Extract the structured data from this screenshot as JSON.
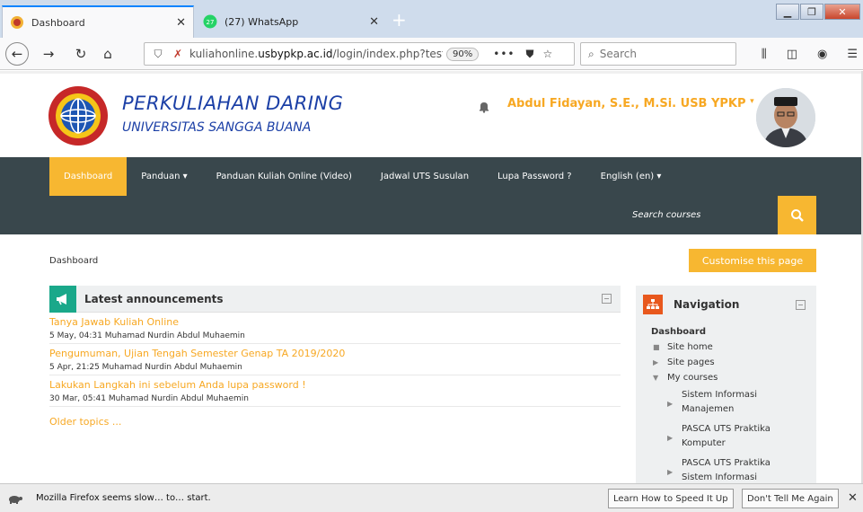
{
  "browser": {
    "tabs": [
      {
        "title": "Dashboard",
        "active": true
      },
      {
        "title": "(27) WhatsApp",
        "active": false
      }
    ],
    "url_domain": "usbypkp.ac.id",
    "url_prefix": "kuliahonline.",
    "url_path": "/login/index.php?tests",
    "zoom": "90%",
    "search_placeholder": "Search"
  },
  "site": {
    "brand_line1": "PERKULIAHAN DARING",
    "brand_line2": "UNIVERSITAS SANGGA BUANA",
    "user_name": "Abdul Fidayan, S.E., M.Si. USB YPKP",
    "accent_color": "#f7b731",
    "nav_bg_color": "#39474c"
  },
  "menu": [
    {
      "label": "Dashboard",
      "active": true
    },
    {
      "label": "Panduan ▾",
      "active": false
    },
    {
      "label": "Panduan Kuliah Online (Video)",
      "active": false
    },
    {
      "label": "Jadwal UTS Susulan",
      "active": false
    },
    {
      "label": "Lupa Password ?",
      "active": false
    },
    {
      "label": "English (en) ▾",
      "active": false
    }
  ],
  "course_search_placeholder": "Search courses",
  "breadcrumb": "Dashboard",
  "customise_label": "Customise this page",
  "announcements": {
    "title": "Latest announcements",
    "posts": [
      {
        "title": "Tanya Jawab Kuliah Online",
        "meta": "5 May, 04:31  Muhamad Nurdin Abdul Muhaemin"
      },
      {
        "title": "Pengumuman, Ujian Tengah Semester Genap TA 2019/2020",
        "meta": "5 Apr, 21:25  Muhamad Nurdin Abdul Muhaemin"
      },
      {
        "title": "Lakukan Langkah ini sebelum Anda lupa password !",
        "meta": "30 Mar, 05:41  Muhamad Nurdin Abdul Muhaemin"
      }
    ],
    "older_label": "Older topics ..."
  },
  "navigation": {
    "title": "Navigation",
    "dashboard": "Dashboard",
    "items": [
      {
        "label": "Site home",
        "bullet": "■"
      },
      {
        "label": "Site pages",
        "bullet": "▶"
      },
      {
        "label": "My courses",
        "bullet": "▼"
      }
    ],
    "courses": [
      "Sistem Informasi Manajemen",
      "PASCA UTS Praktika Komputer",
      "PASCA UTS Praktika Sistem Informasi"
    ]
  },
  "notification": {
    "message": "Mozilla Firefox seems slow… to… start.",
    "button1": "Learn How to Speed It Up",
    "button2": "Don't Tell Me Again"
  }
}
